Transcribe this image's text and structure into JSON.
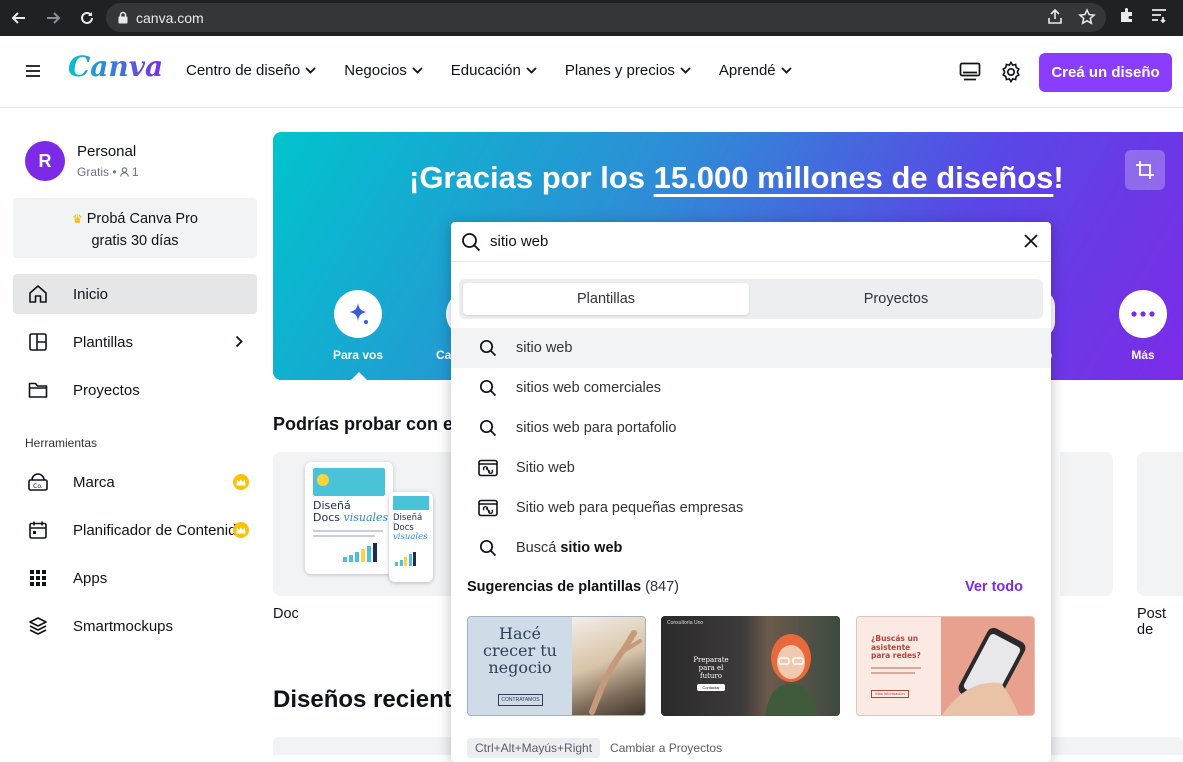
{
  "browser": {
    "url": "canva.com"
  },
  "header": {
    "logo": "Canva",
    "nav": [
      "Centro de diseño",
      "Negocios",
      "Educación",
      "Planes y precios",
      "Aprendé"
    ],
    "create_button": "Creá un diseño"
  },
  "account": {
    "initial": "R",
    "name": "Personal",
    "plan": "Gratis • ",
    "members": "1"
  },
  "promo": {
    "line1": "Probá Canva Pro",
    "line2": "gratis 30 días"
  },
  "sidebar": {
    "items": [
      {
        "label": "Inicio",
        "icon": "home-icon"
      },
      {
        "label": "Plantillas",
        "icon": "templates-icon"
      },
      {
        "label": "Proyectos",
        "icon": "folder-icon"
      }
    ],
    "tools_heading": "Herramientas",
    "tools": [
      {
        "label": "Marca",
        "icon": "brand-icon"
      },
      {
        "label": "Planificador de Contenido",
        "icon": "calendar-icon"
      },
      {
        "label": "Apps",
        "icon": "apps-grid-icon"
      },
      {
        "label": "Smartmockups",
        "icon": "layers-icon"
      }
    ]
  },
  "banner": {
    "title_prefix": "¡Gracias por los ",
    "title_highlight": "15.000 millones de diseños",
    "title_suffix": "!",
    "categories": [
      {
        "label": "Para vos",
        "icon": "sparkle-icon"
      },
      {
        "label": "Ca",
        "icon": ""
      },
      {
        "label": "b",
        "icon": ""
      },
      {
        "label": "Más",
        "icon": "more-icon"
      }
    ]
  },
  "main": {
    "section_title": "Podrías probar con e",
    "cards": [
      {
        "label": "Doc",
        "doc_title1": "Diseñá",
        "doc_title2": "Docs",
        "doc_title3": "visuales"
      },
      {
        "label": "Post de"
      }
    ],
    "recent_title": "Diseños recient"
  },
  "search": {
    "query": "sitio web",
    "tabs": [
      "Plantillas",
      "Proyectos"
    ],
    "suggestions": [
      {
        "text": "sitio web",
        "icon": "search-icon"
      },
      {
        "text": "sitios web comerciales",
        "icon": "search-icon"
      },
      {
        "text": "sitios web para portafolio",
        "icon": "search-icon"
      },
      {
        "text": "Sitio web",
        "icon": "website-icon"
      },
      {
        "text": "Sitio web para pequeñas empresas",
        "icon": "website-icon"
      }
    ],
    "search_for_prefix": "Buscá ",
    "search_for_term": "sitio web",
    "templates_heading": "Sugerencias de plantillas",
    "templates_count": "(847)",
    "see_all": "Ver todo",
    "thumbs": [
      {
        "line1": "Hacé",
        "line2": "crecer tu",
        "line3": "negocio",
        "cta": "CONTRATAMOS"
      },
      {
        "brand": "Consultoría Uno",
        "line1": "Preparate",
        "line2": "para el",
        "line3": "futuro",
        "cta": "Contactar"
      },
      {
        "line1": "¿Buscás un",
        "line2": "asistente",
        "line3": "para redes?",
        "cta": "Más información"
      }
    ],
    "footer_shortcut": "Ctrl+Alt+Mayús+Right",
    "footer_hint": "Cambiar a Proyectos"
  }
}
